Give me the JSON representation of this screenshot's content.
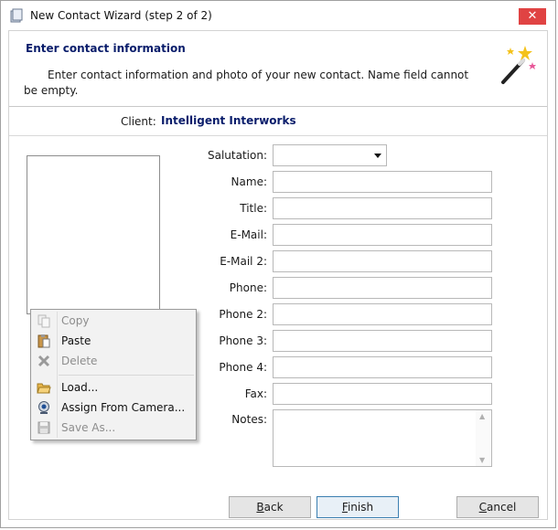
{
  "window": {
    "title": "New Contact Wizard  (step 2 of 2)",
    "close_glyph": "✕"
  },
  "header": {
    "title": "Enter contact information",
    "description_line1": "Enter contact information and photo of your new contact. Name field cannot",
    "description_line2": "be empty."
  },
  "client": {
    "label": "Client:",
    "value": "Intelligent Interworks"
  },
  "form": {
    "salutation_label": "Salutation:",
    "name_label": "Name:",
    "title_label": "Title:",
    "email_label": "E-Mail:",
    "email2_label": "E-Mail 2:",
    "phone_label": "Phone:",
    "phone2_label": "Phone 2:",
    "phone3_label": "Phone 3:",
    "phone4_label": "Phone 4:",
    "fax_label": "Fax:",
    "notes_label": "Notes:",
    "salutation_value": "",
    "name_value": "",
    "title_value": "",
    "email_value": "",
    "email2_value": "",
    "phone_value": "",
    "phone2_value": "",
    "phone3_value": "",
    "phone4_value": "",
    "fax_value": "",
    "notes_value": ""
  },
  "context_menu": {
    "items": [
      {
        "label": "Copy",
        "icon": "copy-icon",
        "enabled": false
      },
      {
        "label": "Paste",
        "icon": "paste-icon",
        "enabled": true
      },
      {
        "label": "Delete",
        "icon": "delete-icon",
        "enabled": false
      },
      {
        "label": "Load...",
        "icon": "folder-open-icon",
        "enabled": true
      },
      {
        "label": "Assign From Camera...",
        "icon": "webcam-icon",
        "enabled": true
      },
      {
        "label": "Save As...",
        "icon": "save-icon",
        "enabled": false
      }
    ]
  },
  "buttons": {
    "back_mnemonic": "B",
    "back_rest": "ack",
    "finish_mnemonic": "F",
    "finish_rest": "inish",
    "cancel_mnemonic": "C",
    "cancel_rest": "ancel"
  },
  "colors": {
    "accent_title": "#0a1d6b",
    "close_button": "#e04343",
    "primary_button_border": "#3c7fb1"
  }
}
